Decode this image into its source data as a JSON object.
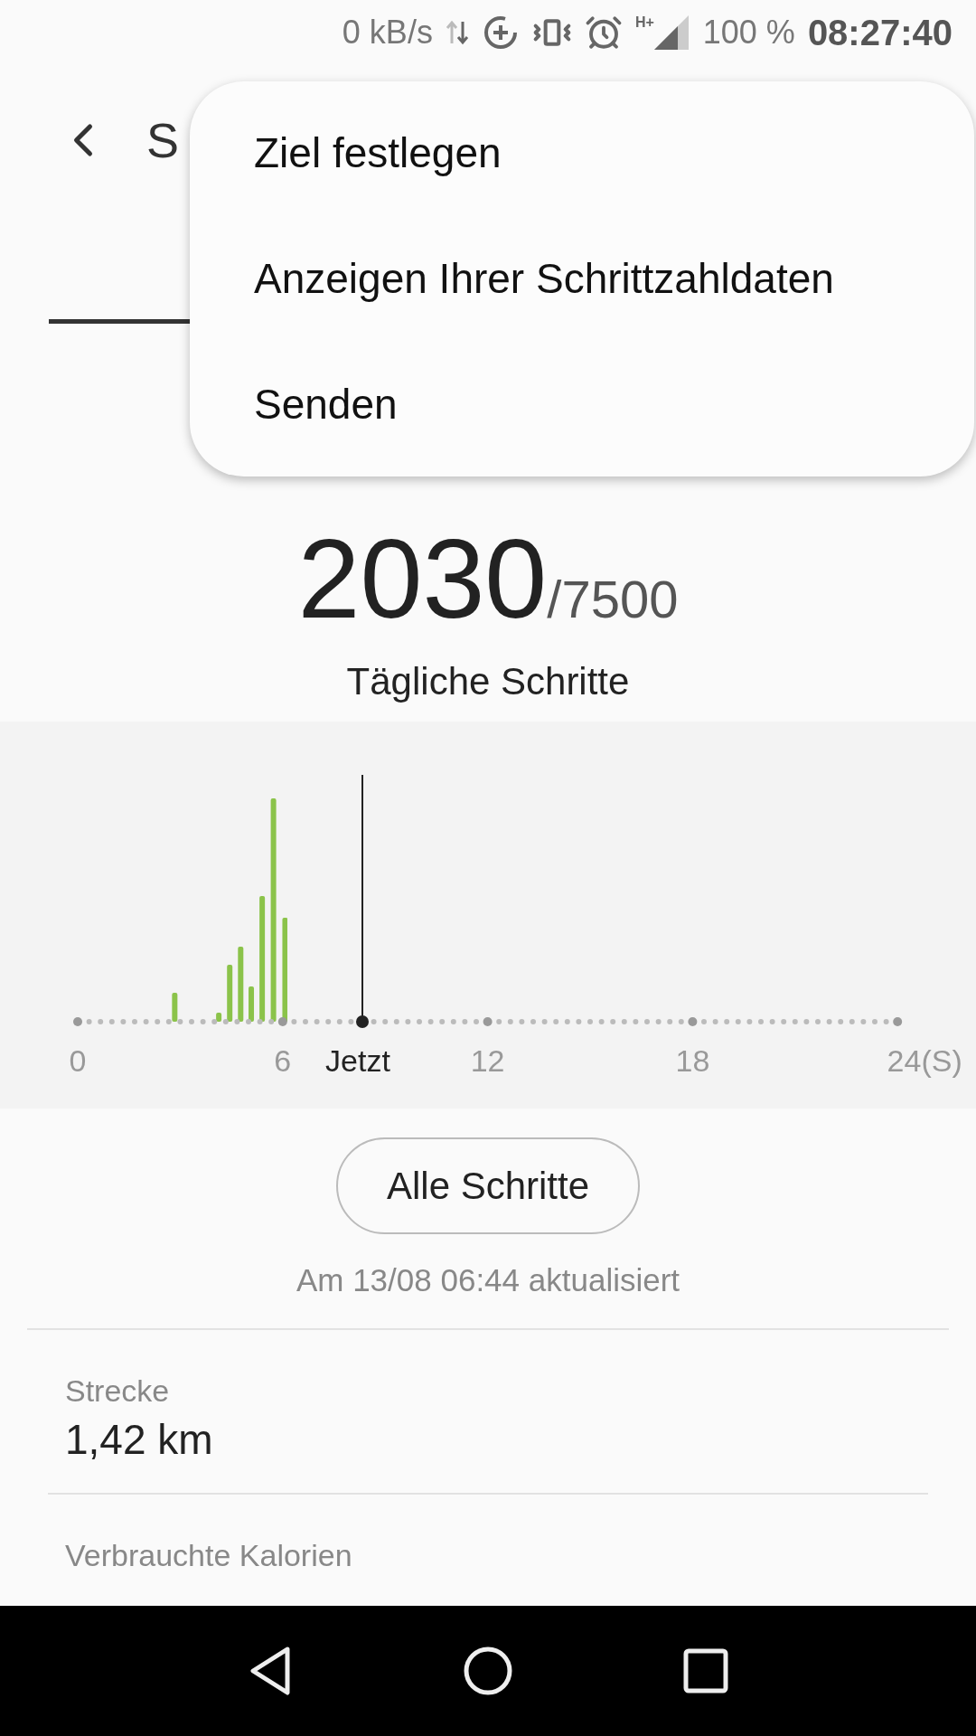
{
  "status_bar": {
    "speed": "0 kB/s",
    "network": "H+",
    "battery": "100 %",
    "time": "08:27:40"
  },
  "header": {
    "title": "S"
  },
  "tabs": [
    {
      "selected": true
    }
  ],
  "menu": {
    "items": [
      {
        "label": "Ziel festlegen"
      },
      {
        "label": "Anzeigen Ihrer Schrittzahldaten"
      },
      {
        "label": "Senden"
      }
    ]
  },
  "steps": {
    "count": "2030",
    "goal": "/7500",
    "label": "Tägliche Schritte"
  },
  "chart": {
    "axis_labels": [
      {
        "label": "0",
        "kind": "tick"
      },
      {
        "label": "6",
        "kind": "tick"
      },
      {
        "label": "Jetzt",
        "kind": "now"
      },
      {
        "label": "12",
        "kind": "tick"
      },
      {
        "label": "18",
        "kind": "tick"
      },
      {
        "label": "24(S)",
        "kind": "tick"
      }
    ]
  },
  "all_steps_button": "Alle Schritte",
  "updated": "Am 13/08 06:44 aktualisiert",
  "stats": [
    {
      "label": "Strecke",
      "value": "1,42 km"
    },
    {
      "label": "Verbrauchte Kalorien"
    }
  ]
}
